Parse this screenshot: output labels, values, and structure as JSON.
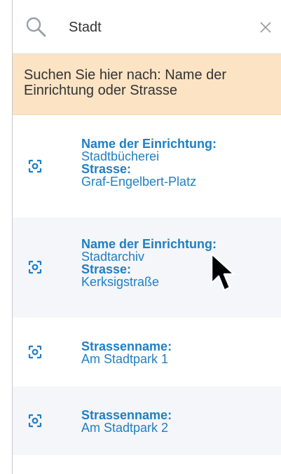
{
  "search": {
    "value": "Stadt",
    "icon": "search-icon",
    "clear_icon": "close-icon"
  },
  "hint": "Suchen Sie hier nach: Name der Einrichtung oder Strasse",
  "colors": {
    "accent": "#1f7fc4",
    "hint_bg": "#fbe3c4",
    "row_alt": "#f4f6f9"
  },
  "results": [
    {
      "label1": "Name der Einrichtung:",
      "value1": "Stadtbücherei",
      "label2": "Strasse:",
      "value2": "Graf-Engelbert-Platz",
      "icon": "locate-icon"
    },
    {
      "label1": "Name der Einrichtung:",
      "value1": "Stadtarchiv",
      "label2": "Strasse:",
      "value2": "Kerksigstraße",
      "icon": "locate-icon"
    },
    {
      "label1": "Strassenname:",
      "value1": "Am Stadtpark 1",
      "icon": "locate-icon"
    },
    {
      "label1": "Strassenname:",
      "value1": "Am Stadtpark 2",
      "icon": "locate-icon"
    }
  ]
}
